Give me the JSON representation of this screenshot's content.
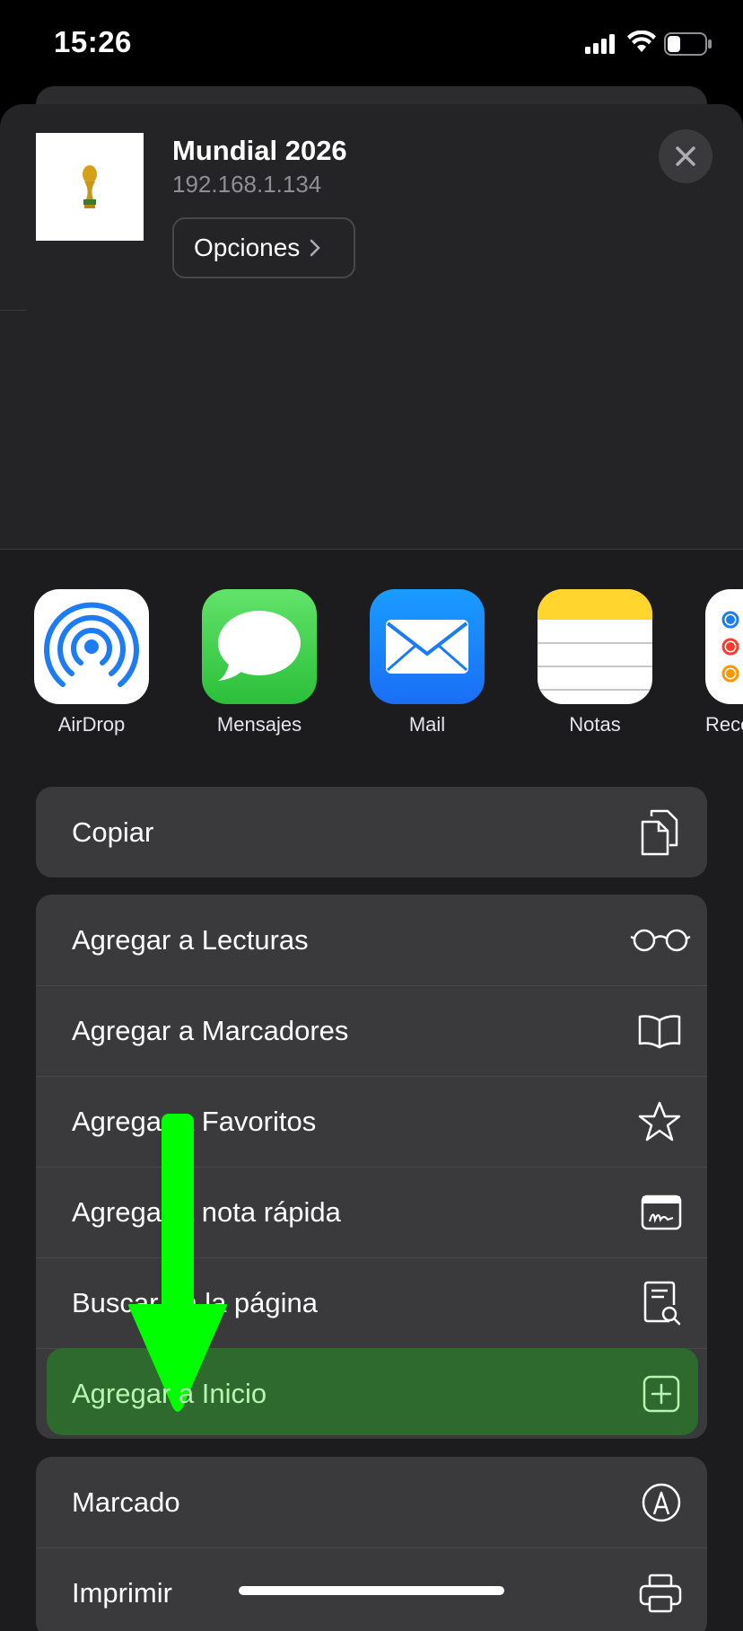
{
  "status_bar": {
    "time": "15:26"
  },
  "share_sheet": {
    "title": "Mundial 2026",
    "subtitle": "192.168.1.134",
    "options_label": "Opciones"
  },
  "apps": [
    {
      "label": "AirDrop",
      "icon": "airdrop-icon"
    },
    {
      "label": "Mensajes",
      "icon": "messages-icon"
    },
    {
      "label": "Mail",
      "icon": "mail-icon"
    },
    {
      "label": "Notas",
      "icon": "notes-icon"
    },
    {
      "label": "Reco",
      "icon": "reminders-icon"
    }
  ],
  "actions": {
    "copy": "Copiar",
    "reading_list": "Agregar a Lecturas",
    "bookmarks": "Agregar a Marcadores",
    "favorites": "Agregar a Favoritos",
    "quick_note": "Agregar a nota rápida",
    "find_in_page": "Buscar en la página",
    "add_to_home": "Agregar a Inicio",
    "markup": "Marcado",
    "print": "Imprimir"
  },
  "colors": {
    "highlight": "#2e6a2e",
    "arrow": "#00ff00"
  }
}
